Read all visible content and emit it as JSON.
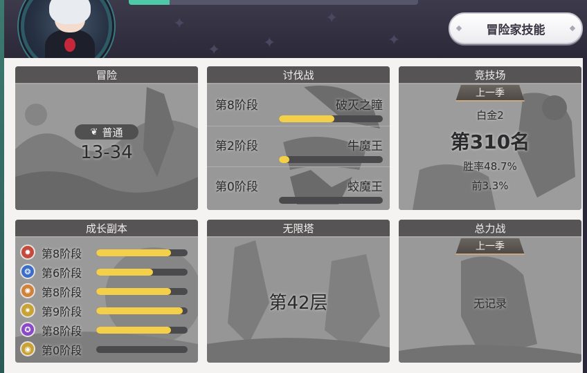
{
  "header": {
    "skill_button": "冒险家技能",
    "xp_progress": 0.14
  },
  "adventure": {
    "title": "冒险",
    "mode": "普通",
    "stage": "13-34"
  },
  "raid": {
    "title": "讨伐战",
    "bosses": [
      {
        "stage": "第8阶段",
        "name": "破灭之瞳",
        "progress": 0.53
      },
      {
        "stage": "第2阶段",
        "name": "牛魔王",
        "progress": 0.1
      },
      {
        "stage": "第0阶段",
        "name": "蛟魔王",
        "progress": 0.0
      }
    ]
  },
  "arena": {
    "title": "竞技场",
    "season": "上一季",
    "tier": "白金2",
    "rank": "第310名",
    "winrate": "胜率48.7%",
    "top": "前3.3%"
  },
  "growth": {
    "title": "成长副本",
    "colors": [
      "#c44a3e",
      "#3a6ec8",
      "#d0823a",
      "#c9a236",
      "#8a4ac8",
      "#c9a236"
    ],
    "items": [
      {
        "icon": "fire-element-icon",
        "stage": "第8阶段",
        "progress": 0.82
      },
      {
        "icon": "water-element-icon",
        "stage": "第6阶段",
        "progress": 0.62
      },
      {
        "icon": "earth-element-icon",
        "stage": "第8阶段",
        "progress": 0.82
      },
      {
        "icon": "light-element-icon",
        "stage": "第9阶段",
        "progress": 0.95
      },
      {
        "icon": "dark-element-icon",
        "stage": "第8阶段",
        "progress": 0.82
      },
      {
        "icon": "gold-coin-icon",
        "stage": "第0阶段",
        "progress": 0.0
      }
    ]
  },
  "tower": {
    "title": "无限塔",
    "floor": "第42层"
  },
  "total_war": {
    "title": "总力战",
    "season": "上一季",
    "record": "无记录"
  }
}
